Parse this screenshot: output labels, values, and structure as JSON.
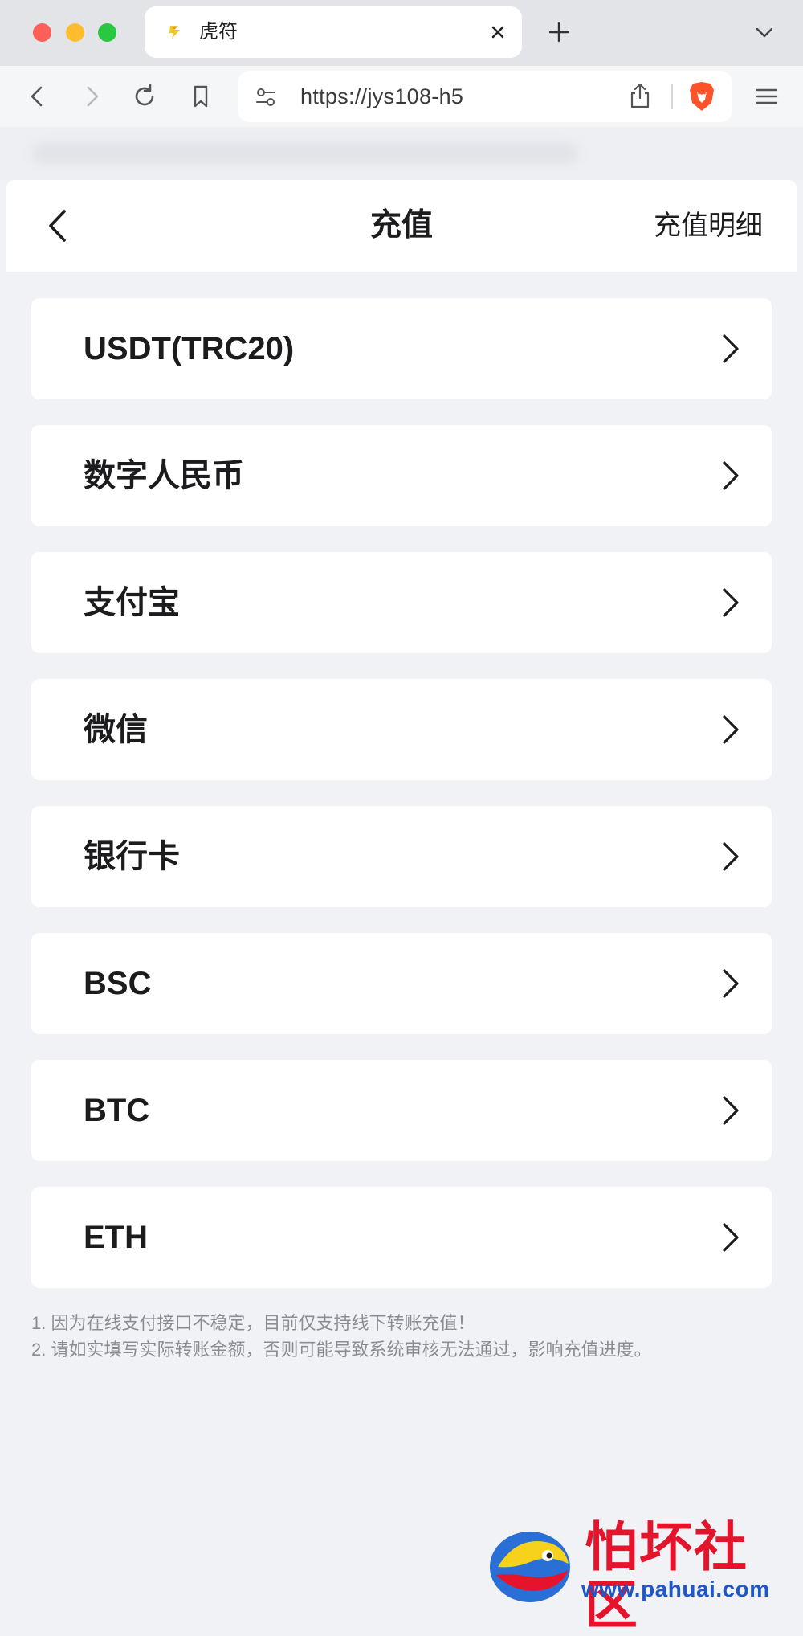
{
  "browser": {
    "tab": {
      "title": "虎符",
      "favicon": "hufu-logo-icon"
    },
    "address": {
      "url": "https://jys108-h5"
    },
    "icons": [
      "back-icon",
      "forward-icon",
      "reload-icon",
      "bookmark-icon",
      "site-settings-icon",
      "share-icon",
      "brave-shield-icon",
      "menu-icon",
      "plus-icon",
      "chevron-down-icon",
      "close-icon"
    ]
  },
  "header": {
    "title": "充值",
    "detail_link": "充值明细"
  },
  "methods": [
    {
      "label": "USDT(TRC20)"
    },
    {
      "label": "数字人民币"
    },
    {
      "label": "支付宝"
    },
    {
      "label": "微信"
    },
    {
      "label": "银行卡"
    },
    {
      "label": "BSC"
    },
    {
      "label": "BTC"
    },
    {
      "label": "ETH"
    }
  ],
  "notes": [
    "1. 因为在线支付接口不稳定，目前仅支持线下转账充值！",
    "2. 请如实填写实际转账金额，否则可能导致系统审核无法通过，影响充值进度。"
  ],
  "watermark": {
    "name": "怕坏社区",
    "url": "www.pahuai.com"
  },
  "colors": {
    "page_bg": "#f1f2f5",
    "card_bg": "#ffffff",
    "text": "#1c1c1e",
    "note_text": "#8a8d93",
    "watermark_red": "#e3142b",
    "watermark_blue": "#1d57c9"
  }
}
